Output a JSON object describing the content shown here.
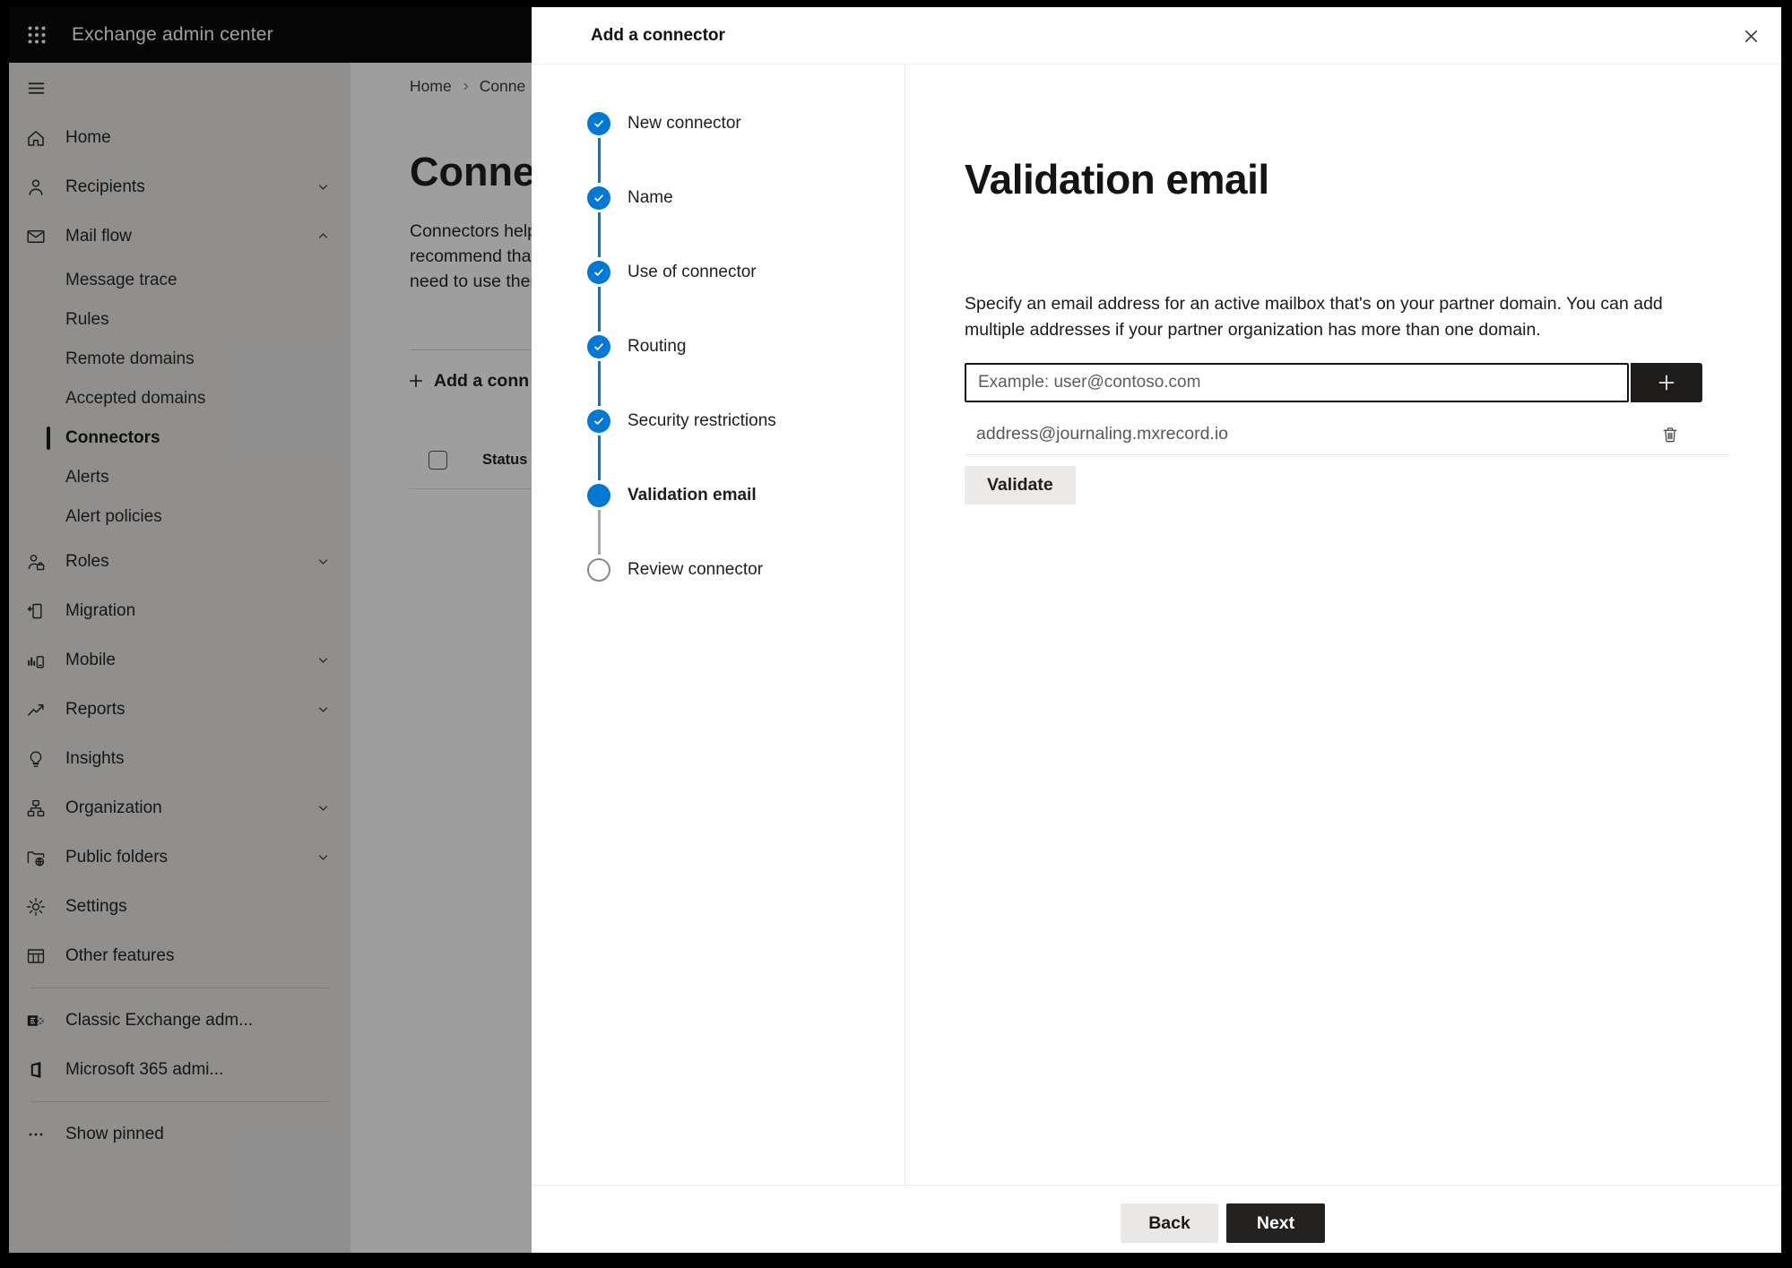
{
  "topbar": {
    "title": "Exchange admin center"
  },
  "sidebar": {
    "items": [
      {
        "label": "Home"
      },
      {
        "label": "Recipients",
        "chevron": "down"
      },
      {
        "label": "Mail flow",
        "chevron": "up",
        "expanded": true
      },
      {
        "label": "Message trace"
      },
      {
        "label": "Rules"
      },
      {
        "label": "Remote domains"
      },
      {
        "label": "Accepted domains"
      },
      {
        "label": "Connectors",
        "selected": true
      },
      {
        "label": "Alerts"
      },
      {
        "label": "Alert policies"
      },
      {
        "label": "Roles",
        "chevron": "down"
      },
      {
        "label": "Migration"
      },
      {
        "label": "Mobile",
        "chevron": "down"
      },
      {
        "label": "Reports",
        "chevron": "down"
      },
      {
        "label": "Insights"
      },
      {
        "label": "Organization",
        "chevron": "down"
      },
      {
        "label": "Public folders",
        "chevron": "down"
      },
      {
        "label": "Settings"
      },
      {
        "label": "Other features"
      },
      {
        "label": "Classic Exchange adm..."
      },
      {
        "label": "Microsoft 365 admi..."
      },
      {
        "label": "Show pinned"
      }
    ]
  },
  "page": {
    "breadcrumb": {
      "home": "Home",
      "current": "Conne"
    },
    "title": "Connec",
    "intro_lines": [
      "Connectors help",
      "recommend that",
      "need to use ther"
    ],
    "add_connector_label": "Add a conn",
    "table_header": "Status"
  },
  "dialog": {
    "title": "Add a connector",
    "steps": [
      {
        "label": "New connector",
        "state": "completed"
      },
      {
        "label": "Name",
        "state": "completed"
      },
      {
        "label": "Use of connector",
        "state": "completed"
      },
      {
        "label": "Routing",
        "state": "completed"
      },
      {
        "label": "Security restrictions",
        "state": "completed"
      },
      {
        "label": "Validation email",
        "state": "current"
      },
      {
        "label": "Review connector",
        "state": "upcoming"
      }
    ],
    "content": {
      "heading": "Validation email",
      "description_line1": "Specify an email address for an active mailbox that's on your partner domain. You can add",
      "description_line2": "multiple addresses if your partner organization has more than one domain.",
      "email_placeholder": "Example: user@contoso.com",
      "added_address": "address@journaling.mxrecord.io",
      "validate_label": "Validate"
    },
    "footer": {
      "back_label": "Back",
      "next_label": "Next"
    }
  },
  "colors": {
    "accent": "#0078d4",
    "topbar_bg": "#0c0b0b",
    "dark_button": "#232221"
  }
}
